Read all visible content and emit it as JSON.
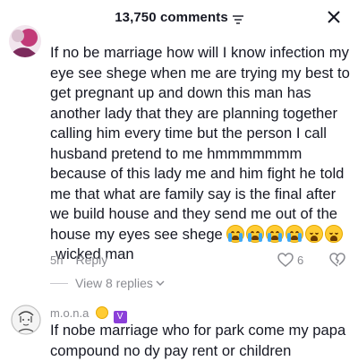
{
  "header": {
    "title": "13,750 comments",
    "filter_icon": "filter-icon",
    "close_icon": "close-icon"
  },
  "comments": [
    {
      "username": "",
      "text": "If no be marriage how will I know infection my eye see shege when me are trying my best to get pregnant up and down this man has another lady that they are planning together calling him every time but the person I call husband pretend to me hmmmmmmm because of this lady me and him fight he told me that what are family say is the final after we build house and they send me out of the house my eyes see shege",
      "text_end": "wicked man",
      "emojis": [
        "loudly-crying-face",
        "loudly-crying-face",
        "loudly-crying-face",
        "loudly-crying-face",
        "weary-face",
        "weary-face"
      ],
      "time": "5h",
      "reply_label": "Reply",
      "likes": "6",
      "view_replies": "View 8 replies"
    },
    {
      "username": "m.o.n.a",
      "badges": [
        "astonished-face",
        "V"
      ],
      "text": "If nobe marriage who for park come my papa compound no dy pay rent or children"
    }
  ],
  "colors": {
    "text_primary": "#161823",
    "text_secondary": "#8a8b91",
    "emoji_yellow": "#ffcc33",
    "badge_purple": "#8b3fd9"
  }
}
